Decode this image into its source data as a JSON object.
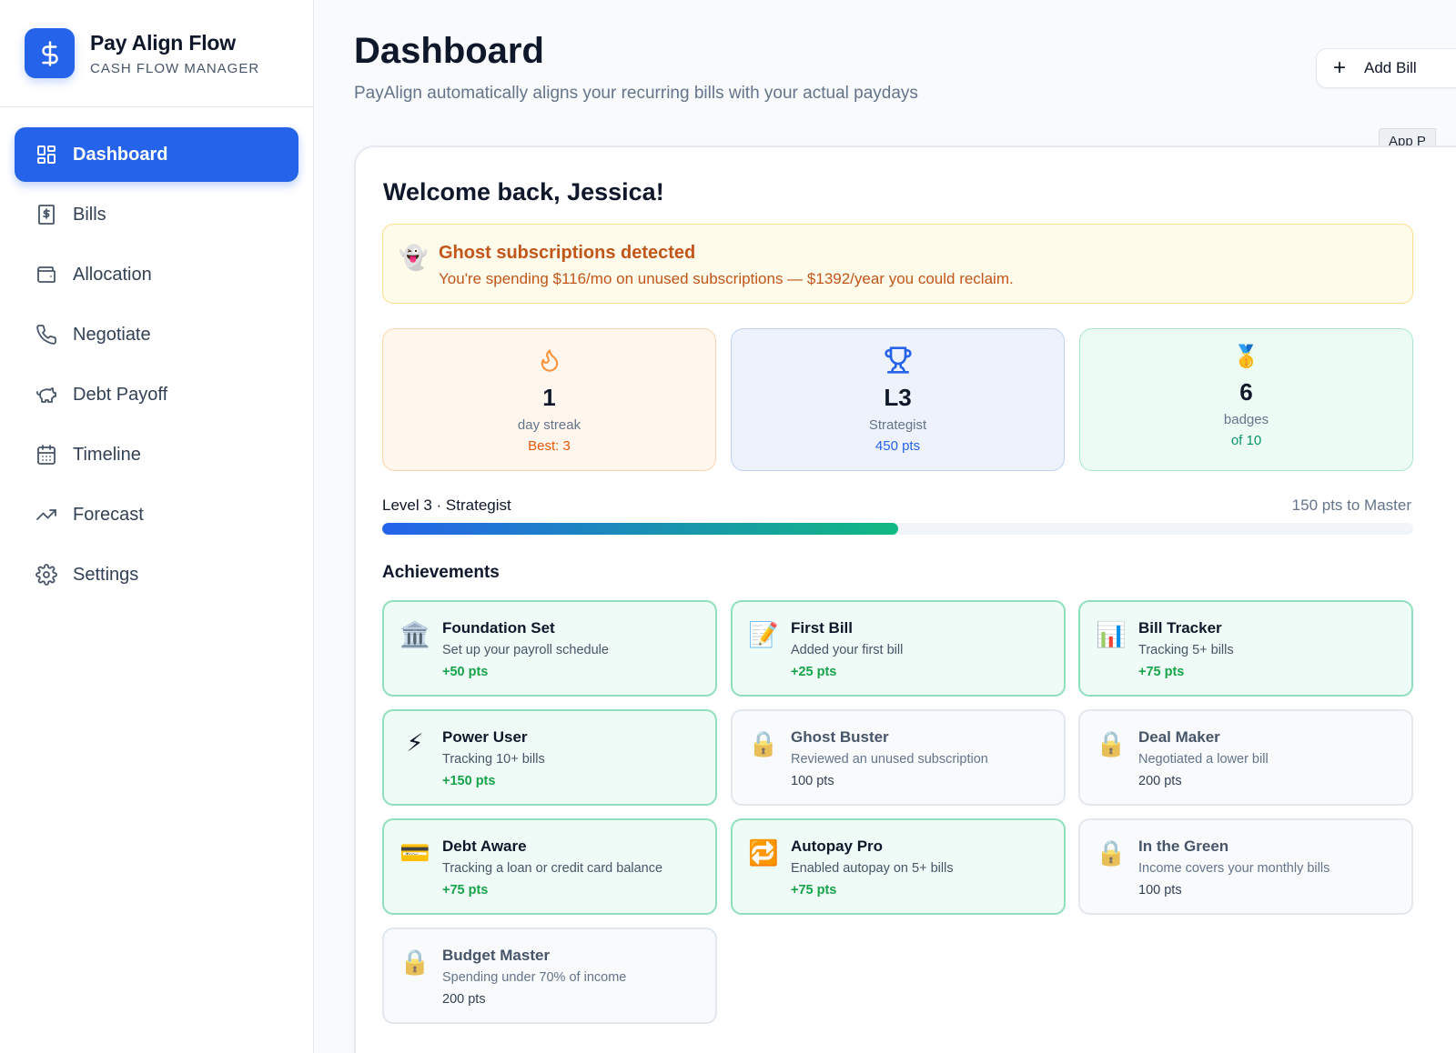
{
  "app": {
    "name": "Pay Align Flow",
    "tagline": "CASH FLOW MANAGER"
  },
  "sidebar": {
    "items": [
      {
        "label": "Dashboard",
        "icon": "dashboard-icon",
        "active": true
      },
      {
        "label": "Bills",
        "icon": "receipt-dollar-icon"
      },
      {
        "label": "Allocation",
        "icon": "wallet-icon"
      },
      {
        "label": "Negotiate",
        "icon": "phone-icon"
      },
      {
        "label": "Debt Payoff",
        "icon": "piggy-bank-icon"
      },
      {
        "label": "Timeline",
        "icon": "calendar-icon"
      },
      {
        "label": "Forecast",
        "icon": "trending-up-icon"
      },
      {
        "label": "Settings",
        "icon": "gear-icon"
      }
    ]
  },
  "header": {
    "title": "Dashboard",
    "subtitle": "PayAlign automatically aligns your recurring bills with your actual paydays",
    "add_bill_label": "Add Bill",
    "app_tag": "App P"
  },
  "welcome": "Welcome back, Jessica!",
  "alert": {
    "icon": "ghost-icon",
    "title": "Ghost subscriptions detected",
    "text": "You're spending $116/mo on unused subscriptions — $1392/year you could reclaim."
  },
  "stats": {
    "streak": {
      "value": "1",
      "label": "day streak",
      "sub": "Best: 3",
      "icon": "flame-icon"
    },
    "level": {
      "value": "L3",
      "label": "Strategist",
      "sub": "450 pts",
      "icon": "trophy-icon"
    },
    "badges": {
      "value": "6",
      "label": "badges",
      "sub": "of 10",
      "icon": "medal-icon"
    }
  },
  "progress": {
    "label": "Level 3 · Strategist",
    "remaining": "150 pts to Master",
    "fraction": 0.5
  },
  "achievements_title": "Achievements",
  "achievements": [
    {
      "name": "Foundation Set",
      "desc": "Set up your payroll schedule",
      "pts": "+50 pts",
      "unlocked": true,
      "icon": "🏛️"
    },
    {
      "name": "First Bill",
      "desc": "Added your first bill",
      "pts": "+25 pts",
      "unlocked": true,
      "icon": "📝"
    },
    {
      "name": "Bill Tracker",
      "desc": "Tracking 5+ bills",
      "pts": "+75 pts",
      "unlocked": true,
      "icon": "📊"
    },
    {
      "name": "Power User",
      "desc": "Tracking 10+ bills",
      "pts": "+150 pts",
      "unlocked": true,
      "icon": "⚡"
    },
    {
      "name": "Ghost Buster",
      "desc": "Reviewed an unused subscription",
      "pts": "100 pts",
      "unlocked": false,
      "icon": "🔒"
    },
    {
      "name": "Deal Maker",
      "desc": "Negotiated a lower bill",
      "pts": "200 pts",
      "unlocked": false,
      "icon": "🔒"
    },
    {
      "name": "Debt Aware",
      "desc": "Tracking a loan or credit card balance",
      "pts": "+75 pts",
      "unlocked": true,
      "icon": "💳"
    },
    {
      "name": "Autopay Pro",
      "desc": "Enabled autopay on 5+ bills",
      "pts": "+75 pts",
      "unlocked": true,
      "icon": "🔁"
    },
    {
      "name": "In the Green",
      "desc": "Income covers your monthly bills",
      "pts": "100 pts",
      "unlocked": false,
      "icon": "🔒"
    },
    {
      "name": "Budget Master",
      "desc": "Spending under 70% of income",
      "pts": "200 pts",
      "unlocked": false,
      "icon": "🔒"
    }
  ],
  "colors": {
    "accent": "#2563eb",
    "success": "#10b981",
    "warning": "#c2561a"
  }
}
